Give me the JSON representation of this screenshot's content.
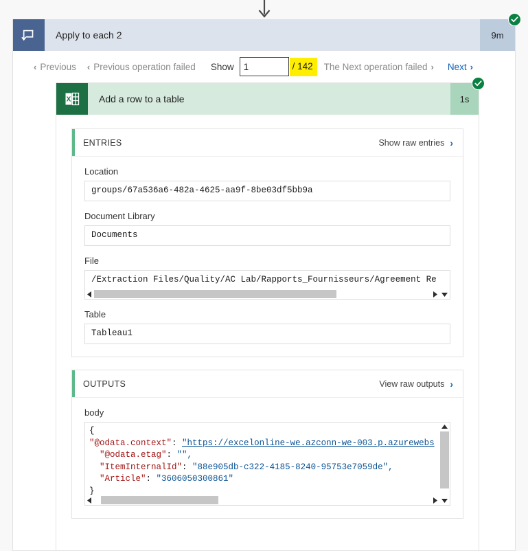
{
  "scope": {
    "icon": "loop-icon",
    "title": "Apply to each 2",
    "duration": "9m",
    "status": "succeeded",
    "status_icon": "check-circle-icon"
  },
  "pager": {
    "previous_label": "Previous",
    "previous_chevron": "‹",
    "previous_failed_label": "Previous operation failed",
    "previous_failed_chevron": "‹",
    "show_label": "Show",
    "current_index": "1",
    "current_index_placeholder": "1",
    "total_label": "/ 142",
    "total_highlight_color": "#ffee00",
    "next_failed_label": "The Next operation failed",
    "next_failed_chevron": "›",
    "next_label": "Next",
    "next_chevron": "›",
    "next_link_color": "#0f62b5"
  },
  "action": {
    "icon": "excel-icon",
    "title": "Add a row to a table",
    "duration": "1s",
    "status": "succeeded",
    "status_icon": "check-circle-icon"
  },
  "entries": {
    "section_title": "ENTRIES",
    "raw_link_label": "Show raw entries",
    "raw_link_chevron": "›",
    "fields": [
      {
        "label": "Location",
        "value": "groups/67a536a6-482a-4625-aa9f-8be03df5bb9a"
      },
      {
        "label": "Document Library",
        "value": "Documents"
      },
      {
        "label": "File",
        "value": "/Extraction Files/Quality/AC Lab/Rapports_Fournisseurs/Agreement Re"
      },
      {
        "label": "Table",
        "value": "Tableau1"
      }
    ]
  },
  "outputs": {
    "section_title": "OUTPUTS",
    "raw_link_label": "View raw outputs",
    "raw_link_chevron": "›",
    "body_label": "body",
    "code_lines": [
      {
        "indent": 0,
        "text": "{",
        "type": "brace"
      },
      {
        "indent": 0,
        "key": "\"@odata.context\"",
        "sep": ": ",
        "value": "\"https://excelonline-we.azconn-we-003.p.azurewebs",
        "type": "url"
      },
      {
        "indent": 2,
        "key": "\"@odata.etag\"",
        "sep": ": ",
        "value": "\"\",",
        "type": "string"
      },
      {
        "indent": 2,
        "key": "\"ItemInternalId\"",
        "sep": ": ",
        "value": "\"88e905db-c322-4185-8240-95753e7059de\",",
        "type": "string"
      },
      {
        "indent": 2,
        "key": "\"Article\"",
        "sep": ": ",
        "value": "\"3606050300861\"",
        "type": "string"
      },
      {
        "indent": 0,
        "text": "}",
        "type": "brace"
      }
    ]
  }
}
